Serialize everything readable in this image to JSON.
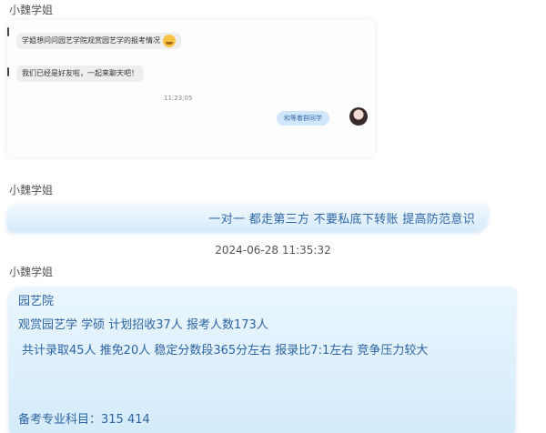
{
  "top_sender": "小魏学姐",
  "embedded_chat": {
    "msg1": "学姐想问问园艺学院观赏园艺学的报考情况",
    "msg2": "我们已经是好友啦，一起来聊天吧！",
    "time": "11:23:05",
    "reply": "和等着群同学"
  },
  "banner_sender": "小魏学姐",
  "banner_text": "一对一  都走第三方  不要私底下转账  提高防范意识",
  "timestamp": "2024-06-28 11:35:32",
  "card_sender": "小魏学姐",
  "card": {
    "line1": "园艺院",
    "line2": "观赏园艺学  学硕  计划招收37人     报考人数173人",
    "line3": "共计录取45人  推免20人      稳定分数段365分左右      报录比7:1左右  竞争压力较大",
    "line4": "备考专业科目：315  414"
  },
  "colors": {
    "bubble_blue": "#d4ebfb",
    "text_blue": "#2d64a0"
  }
}
